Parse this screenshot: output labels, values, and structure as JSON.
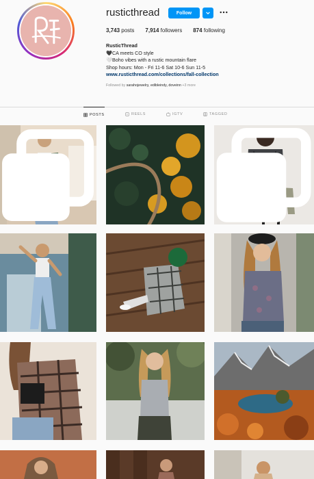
{
  "profile": {
    "username": "rusticthread",
    "follow_label": "Follow",
    "more_label": "•••",
    "stats": {
      "posts_count": "3,743",
      "posts_label": "posts",
      "followers_count": "7,914",
      "followers_label": "followers",
      "following_count": "874",
      "following_label": "following"
    },
    "bio": {
      "name": "RusticThread",
      "line1": "🖤CA meets CO style",
      "line2": "🤍Boho vibes with a rustic mountain flare",
      "line3": "Shop hours: Mon - Fri 11-6 Sat 10-6 Sun 11-5",
      "link": "www.rusticthread.com/collections/fall-collection",
      "followed_prefix": "Followed by",
      "followed_names": "sarahojewelry, edibleindy, doveinn",
      "followed_more": "+3 more"
    }
  },
  "tabs": [
    {
      "label": "POSTS",
      "icon": "grid-icon",
      "active": true
    },
    {
      "label": "REELS",
      "icon": "reels-icon",
      "active": false
    },
    {
      "label": "IGTV",
      "icon": "igtv-icon",
      "active": false
    },
    {
      "label": "TAGGED",
      "icon": "tagged-icon",
      "active": false
    }
  ],
  "posts": [
    {
      "subject": "woman in green plaid shirt jacket, mirror selfie",
      "multi": true
    },
    {
      "subject": "aerial view of road through autumn forest",
      "multi": false
    },
    {
      "subject": "woman in grey long cardigan on stool",
      "multi": true
    },
    {
      "subject": "woman in light jeans and crop top at doorway",
      "multi": false
    },
    {
      "subject": "man in green cap and plaid on stairs",
      "multi": false
    },
    {
      "subject": "woman in black beret and floral blouse",
      "multi": false
    },
    {
      "subject": "woman in brown plaid flannel shirt",
      "multi": false
    },
    {
      "subject": "woman in grey tank top outdoors",
      "multi": false
    },
    {
      "subject": "mountain lake with autumn trees",
      "multi": false
    }
  ],
  "colors": {
    "accent": "#0095f6",
    "avatar_bg": "#e8b4ae",
    "link": "#00376b"
  }
}
